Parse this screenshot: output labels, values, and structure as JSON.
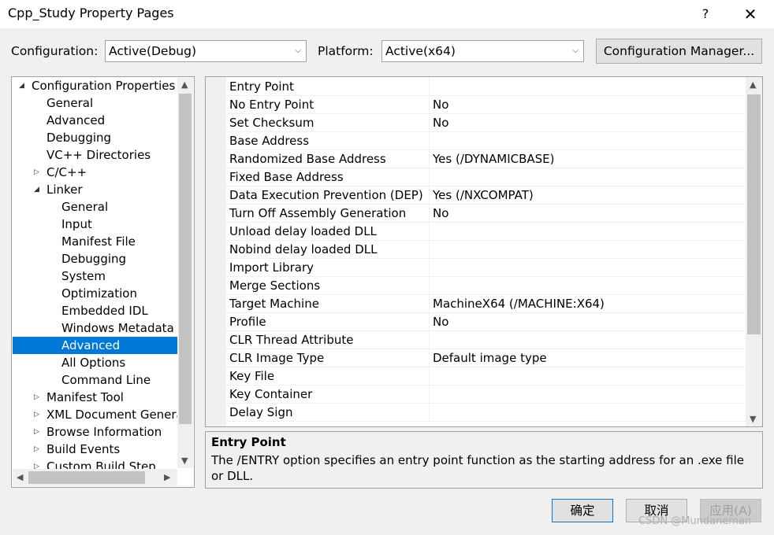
{
  "window": {
    "title": "Cpp_Study Property Pages",
    "help_glyph": "?",
    "close_glyph": "✕"
  },
  "toolbar": {
    "configuration_label": "Configuration:",
    "configuration_value": "Active(Debug)",
    "platform_label": "Platform:",
    "platform_value": "Active(x64)",
    "config_manager_label": "Configuration Manager..."
  },
  "tree": {
    "items": [
      {
        "label": "Configuration Properties",
        "expander": "◢",
        "selected": false
      },
      {
        "label": "General",
        "expander": "",
        "selected": false
      },
      {
        "label": "Advanced",
        "expander": "",
        "selected": false
      },
      {
        "label": "Debugging",
        "expander": "",
        "selected": false
      },
      {
        "label": "VC++ Directories",
        "expander": "",
        "selected": false
      },
      {
        "label": "C/C++",
        "expander": "▷",
        "selected": false
      },
      {
        "label": "Linker",
        "expander": "◢",
        "selected": false
      },
      {
        "label": "General",
        "expander": "",
        "selected": false
      },
      {
        "label": "Input",
        "expander": "",
        "selected": false
      },
      {
        "label": "Manifest File",
        "expander": "",
        "selected": false
      },
      {
        "label": "Debugging",
        "expander": "",
        "selected": false
      },
      {
        "label": "System",
        "expander": "",
        "selected": false
      },
      {
        "label": "Optimization",
        "expander": "",
        "selected": false
      },
      {
        "label": "Embedded IDL",
        "expander": "",
        "selected": false
      },
      {
        "label": "Windows Metadata",
        "expander": "",
        "selected": false
      },
      {
        "label": "Advanced",
        "expander": "",
        "selected": true
      },
      {
        "label": "All Options",
        "expander": "",
        "selected": false
      },
      {
        "label": "Command Line",
        "expander": "",
        "selected": false
      },
      {
        "label": "Manifest Tool",
        "expander": "▷",
        "selected": false
      },
      {
        "label": "XML Document Generator",
        "expander": "▷",
        "selected": false
      },
      {
        "label": "Browse Information",
        "expander": "▷",
        "selected": false
      },
      {
        "label": "Build Events",
        "expander": "▷",
        "selected": false
      },
      {
        "label": "Custom Build Step",
        "expander": "▷",
        "selected": false
      }
    ]
  },
  "grid": {
    "rows": [
      {
        "name": "Entry Point",
        "value": ""
      },
      {
        "name": "No Entry Point",
        "value": "No"
      },
      {
        "name": "Set Checksum",
        "value": "No"
      },
      {
        "name": "Base Address",
        "value": ""
      },
      {
        "name": "Randomized Base Address",
        "value": "Yes (/DYNAMICBASE)"
      },
      {
        "name": "Fixed Base Address",
        "value": ""
      },
      {
        "name": "Data Execution Prevention (DEP)",
        "value": "Yes (/NXCOMPAT)"
      },
      {
        "name": "Turn Off Assembly Generation",
        "value": "No"
      },
      {
        "name": "Unload delay loaded DLL",
        "value": ""
      },
      {
        "name": "Nobind delay loaded DLL",
        "value": ""
      },
      {
        "name": "Import Library",
        "value": ""
      },
      {
        "name": "Merge Sections",
        "value": ""
      },
      {
        "name": "Target Machine",
        "value": "MachineX64 (/MACHINE:X64)"
      },
      {
        "name": "Profile",
        "value": "No"
      },
      {
        "name": "CLR Thread Attribute",
        "value": ""
      },
      {
        "name": "CLR Image Type",
        "value": "Default image type"
      },
      {
        "name": "Key File",
        "value": ""
      },
      {
        "name": "Key Container",
        "value": ""
      },
      {
        "name": "Delay Sign",
        "value": ""
      }
    ]
  },
  "description": {
    "title": "Entry Point",
    "text": "The /ENTRY option specifies an entry point function as the starting address for an .exe file or DLL."
  },
  "buttons": {
    "ok": "确定",
    "cancel": "取消",
    "apply": "应用(A)"
  },
  "watermark": "CSDN @Mundaneman",
  "colors": {
    "selection": "#0078d7",
    "background": "#f0f0f0"
  }
}
